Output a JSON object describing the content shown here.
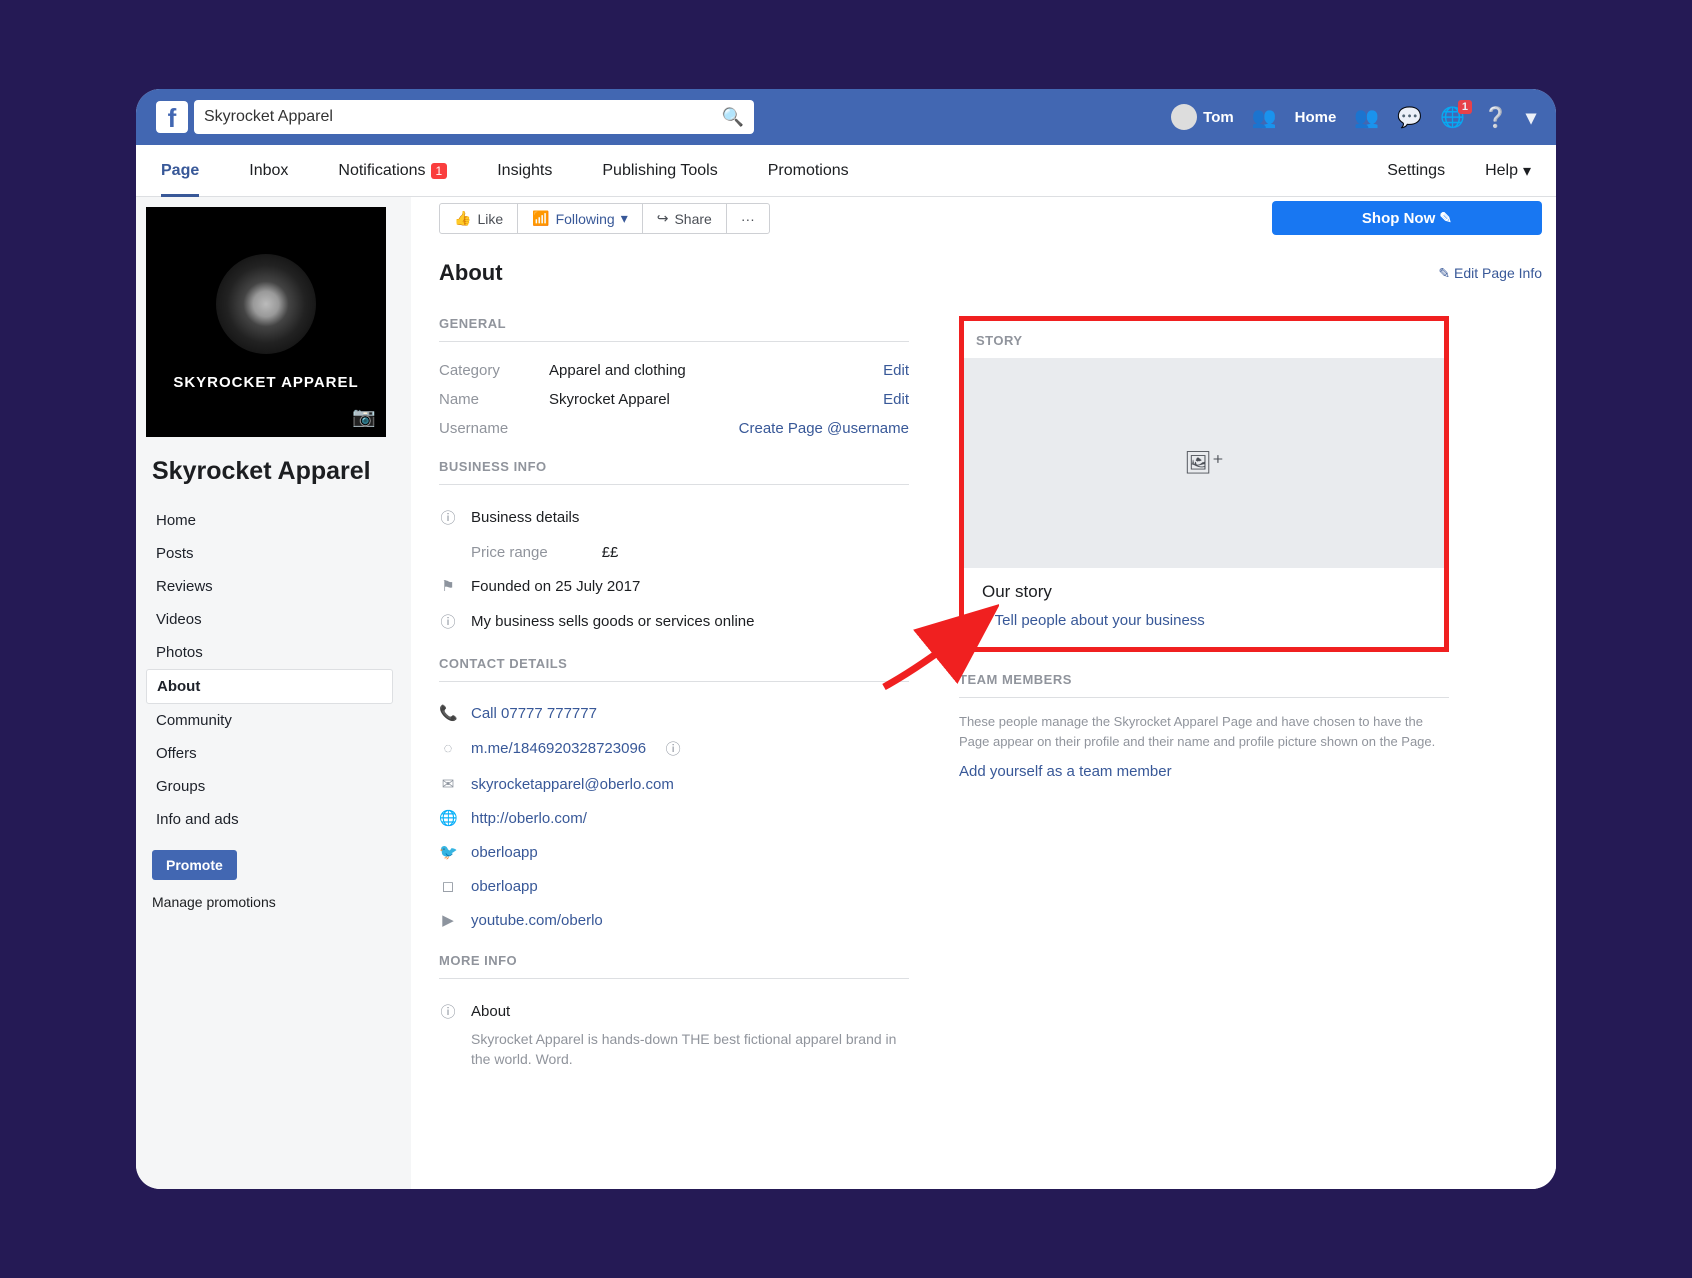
{
  "topbar": {
    "search_value": "Skyrocket Apparel",
    "user_name": "Tom",
    "home": "Home",
    "notification_count": "1"
  },
  "subnav": {
    "items": [
      "Page",
      "Inbox",
      "Notifications",
      "Insights",
      "Publishing Tools",
      "Promotions"
    ],
    "notif_badge": "1",
    "settings": "Settings",
    "help": "Help"
  },
  "page": {
    "photo_label": "SKYROCKET APPAREL",
    "name": "Skyrocket Apparel",
    "menu": [
      "Home",
      "Posts",
      "Reviews",
      "Videos",
      "Photos",
      "About",
      "Community",
      "Offers",
      "Groups",
      "Info and ads"
    ],
    "promote": "Promote",
    "manage_promotions": "Manage promotions"
  },
  "actions": {
    "like": "Like",
    "following": "Following",
    "share": "Share",
    "shop_now": "Shop Now"
  },
  "about": {
    "title": "About",
    "edit_page_info": "Edit Page Info",
    "general": {
      "heading": "GENERAL",
      "category_label": "Category",
      "category_value": "Apparel and clothing",
      "name_label": "Name",
      "name_value": "Skyrocket Apparel",
      "username_label": "Username",
      "username_link": "Create Page @username",
      "edit": "Edit"
    },
    "business": {
      "heading": "BUSINESS INFO",
      "details_label": "Business details",
      "price_label": "Price range",
      "price_value": "££",
      "founded": "Founded on 25 July 2017",
      "sells_online": "My business sells goods or services online"
    },
    "contact": {
      "heading": "CONTACT DETAILS",
      "phone": "Call 07777 777777",
      "messenger": "m.me/1846920328723096",
      "email": "skyrocketapparel@oberlo.com",
      "website": "http://oberlo.com/",
      "twitter": "oberloapp",
      "instagram": "oberloapp",
      "youtube": "youtube.com/oberlo"
    },
    "more": {
      "heading": "MORE INFO",
      "about_label": "About",
      "about_text": "Skyrocket Apparel is hands-down THE best fictional apparel brand in the world. Word."
    },
    "story": {
      "heading": "STORY",
      "title": "Our story",
      "tell_link": "+ Tell people about your business"
    },
    "team": {
      "heading": "TEAM MEMBERS",
      "desc": "These people manage the Skyrocket Apparel Page and have chosen to have the Page appear on their profile and their name and profile picture shown on the Page.",
      "add_link": "Add yourself as a team member"
    }
  }
}
